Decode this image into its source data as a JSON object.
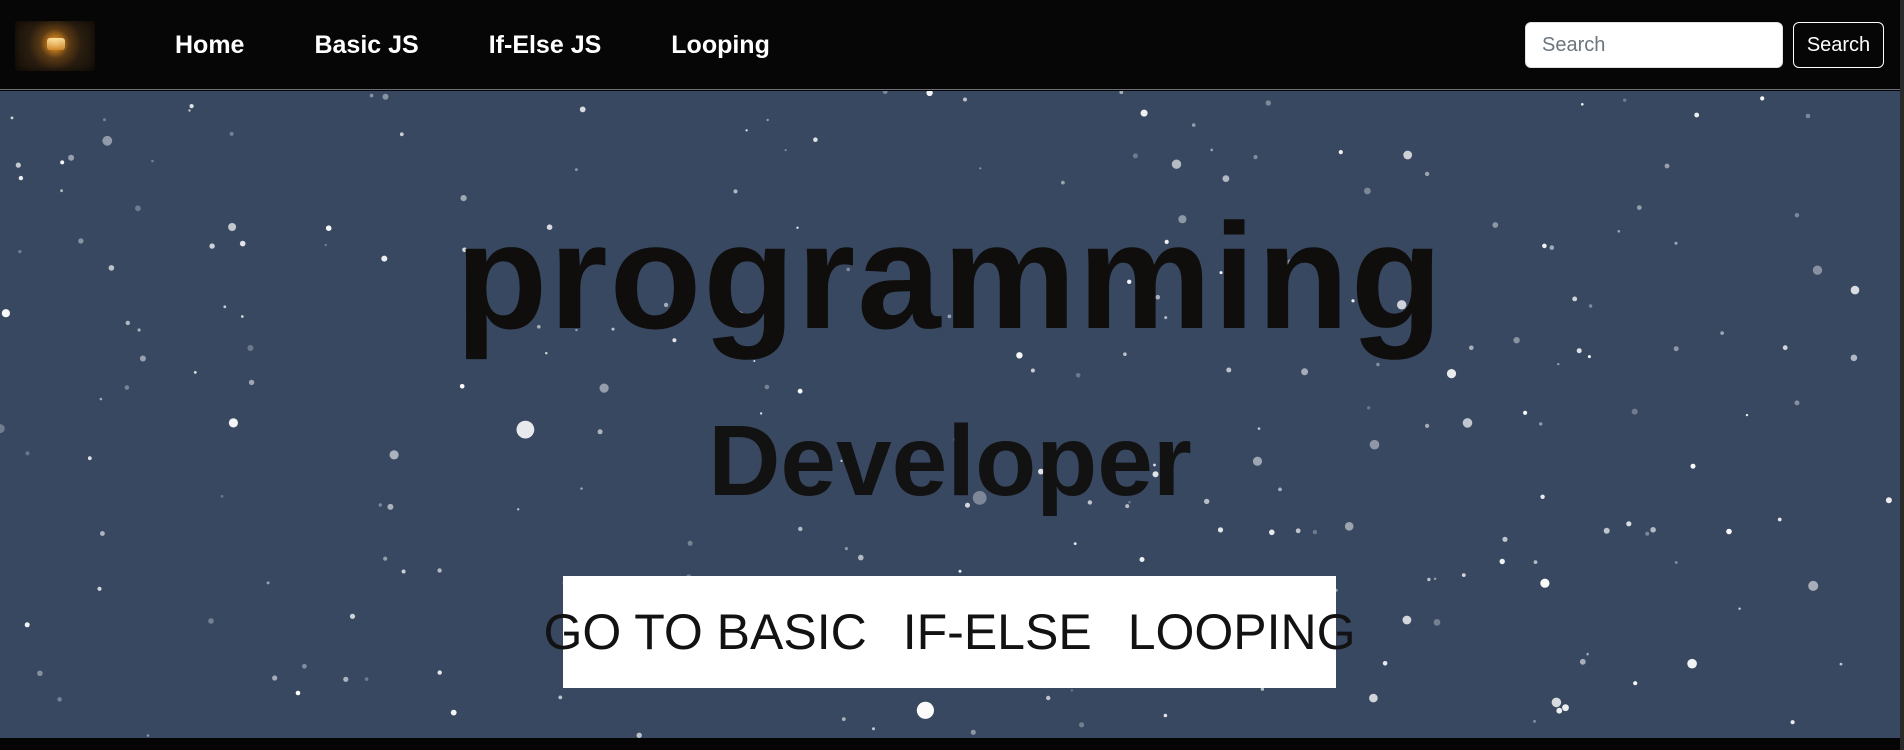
{
  "navbar": {
    "logo_icon": "lantern-logo-icon",
    "links": [
      {
        "label": "Home"
      },
      {
        "label": "Basic JS"
      },
      {
        "label": "If-Else JS"
      },
      {
        "label": "Looping"
      }
    ],
    "search": {
      "placeholder": "Search",
      "value": "",
      "button_label": "Search"
    }
  },
  "hero": {
    "title": "programming",
    "subtitle": "Developer",
    "buttons": [
      {
        "label": "GO TO BASIC"
      },
      {
        "label": "IF-ELSE"
      },
      {
        "label": "LOOPING"
      }
    ]
  },
  "colors": {
    "navbar_bg": "#060606",
    "hero_bg": "#384861",
    "title_text": "#0f0e0d",
    "cta_bg": "#ffffff"
  }
}
